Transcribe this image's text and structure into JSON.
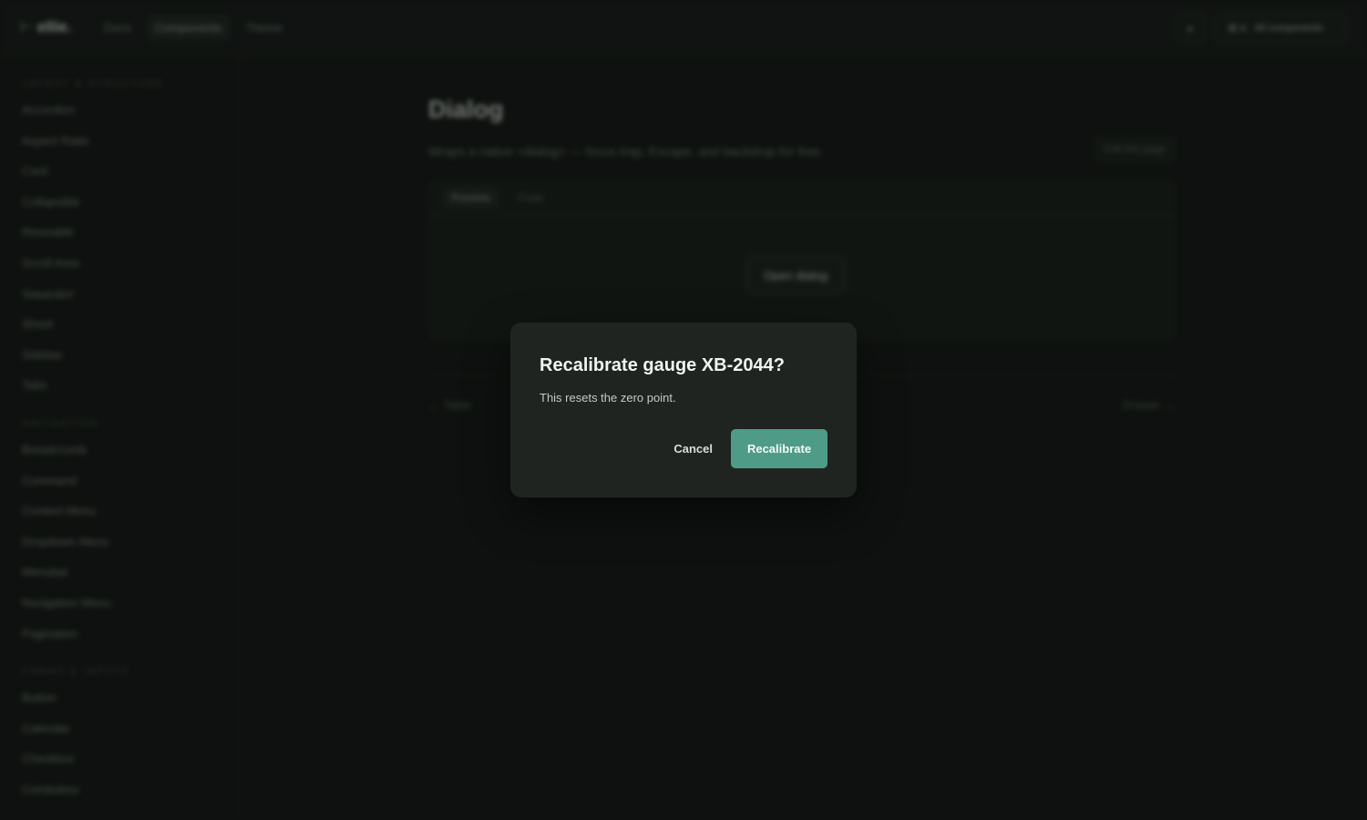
{
  "topbar": {
    "logo_symbol": "⊢",
    "logo_text": "ellie.",
    "nav": [
      {
        "label": "Docs"
      },
      {
        "label": "Components"
      },
      {
        "label": "Theme"
      }
    ],
    "theme_icon": "◐",
    "search_shortcut": "⌘ K",
    "search_label": "All components"
  },
  "sidebar": {
    "groups": [
      {
        "title": "LAYOUT & STRUCTURE",
        "items": [
          "Accordion",
          "Aspect Ratio",
          "Card",
          "Collapsible",
          "Resizable",
          "Scroll Area",
          "Separator",
          "Sheet",
          "Sidebar",
          "Tabs"
        ]
      },
      {
        "title": "NAVIGATION",
        "items": [
          "Breadcrumb",
          "Command",
          "Context Menu",
          "Dropdown Menu",
          "Menubar",
          "Navigation Menu",
          "Pagination"
        ]
      },
      {
        "title": "FORMS & INPUTS",
        "items": [
          "Button",
          "Calendar",
          "Checkbox",
          "Combobox"
        ]
      }
    ]
  },
  "main": {
    "title": "Dialog",
    "description": "Wraps a native <dialog> — focus trap, Escape, and backdrop for free.",
    "link_label": "Edit this page",
    "tabs": [
      {
        "label": "Preview"
      },
      {
        "label": "Code"
      }
    ],
    "open_button": "Open dialog",
    "prev_link": "← Table",
    "next_link": "Drawer →"
  },
  "dialog": {
    "title": "Recalibrate gauge XB-2044?",
    "text": "This resets the zero point.",
    "cancel": "Cancel",
    "confirm": "Recalibrate"
  },
  "colors": {
    "accent": "#4e9c87",
    "background": "#131714",
    "dialog_bg": "#1f2421"
  }
}
